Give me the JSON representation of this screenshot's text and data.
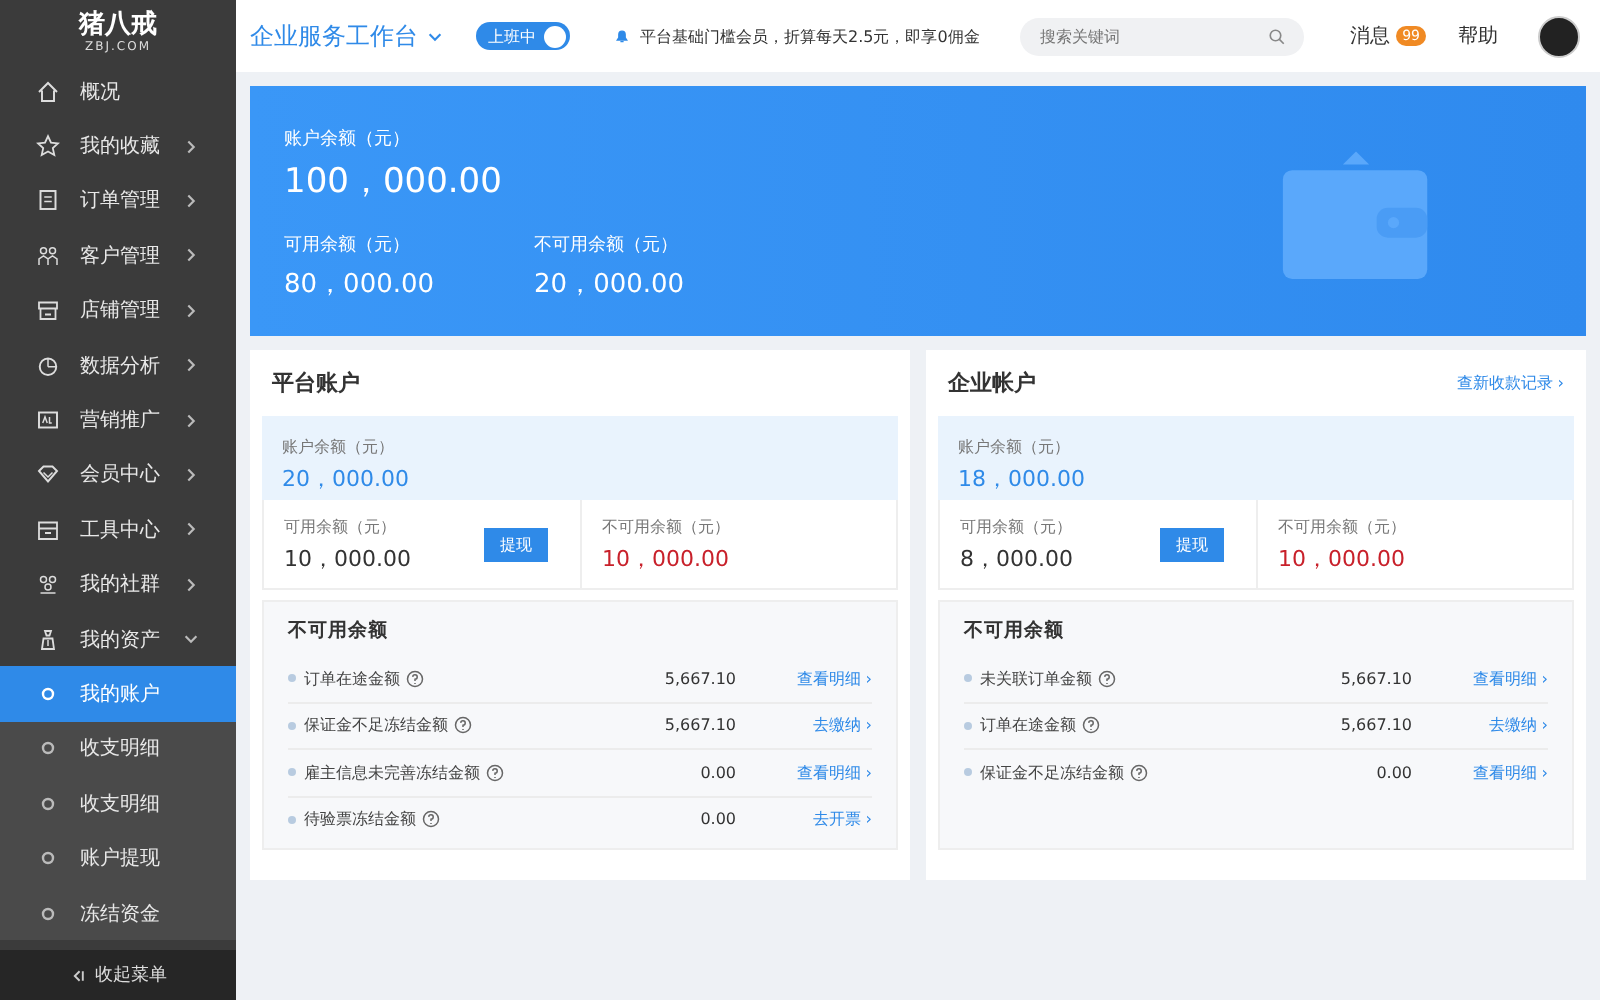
{
  "sidebar": {
    "logo": {
      "name": "猪八戒",
      "domain": "ZBJ.COM"
    },
    "items": [
      {
        "label": "概况",
        "kind": "link"
      },
      {
        "label": "我的收藏",
        "kind": "menu",
        "expanded": false
      },
      {
        "label": "订单管理",
        "kind": "menu",
        "expanded": false
      },
      {
        "label": "客户管理",
        "kind": "menu",
        "expanded": false
      },
      {
        "label": "店铺管理",
        "kind": "menu",
        "expanded": false
      },
      {
        "label": "数据分析",
        "kind": "menu",
        "expanded": false
      },
      {
        "label": "营销推广",
        "kind": "menu",
        "expanded": false
      },
      {
        "label": "会员中心",
        "kind": "menu",
        "expanded": false
      },
      {
        "label": "工具中心",
        "kind": "menu",
        "expanded": false
      },
      {
        "label": "我的社群",
        "kind": "menu",
        "expanded": false
      },
      {
        "label": "我的资产",
        "kind": "menu",
        "expanded": true,
        "children": [
          {
            "label": "我的账户",
            "selected": true
          },
          {
            "label": "收支明细",
            "selected": false
          },
          {
            "label": "收支明细",
            "selected": false
          },
          {
            "label": "账户提现",
            "selected": false
          },
          {
            "label": "冻结资金",
            "selected": false
          }
        ]
      }
    ],
    "collapse": "收起菜单"
  },
  "header": {
    "title": "企业服务工作台",
    "status": {
      "label": "上班中",
      "on": true
    },
    "notice": "平台基础门槛会员，折算每天2.5元，即享0佣金",
    "search": {
      "placeholder": "搜索关键词"
    },
    "messages": {
      "label": "消息",
      "count": "99"
    },
    "help": "帮助"
  },
  "banner": {
    "label": "账户余额（元）",
    "amount": "100，000.00",
    "sub": [
      {
        "label": "可用余额（元）",
        "amount": "80，000.00"
      },
      {
        "label": "不可用余额（元）",
        "amount": "20，000.00"
      }
    ]
  },
  "accounts": [
    {
      "title": "平台账户",
      "balance": {
        "label": "账户余额（元）",
        "amount": "20，000.00"
      },
      "available": {
        "label": "可用余额（元）",
        "amount": "10，000.00",
        "button": "提现"
      },
      "unavailable": {
        "label": "不可用余额（元）",
        "amount": "10，000.00"
      },
      "details": {
        "title": "不可用余额",
        "rows": [
          {
            "label": "订单在途金额",
            "amount": "5,667.10",
            "link": "查看明细 ›"
          },
          {
            "label": "保证金不足冻结金额",
            "amount": "5,667.10",
            "link": "去缴纳 ›"
          },
          {
            "label": "雇主信息未完善冻结金额",
            "amount": "0.00",
            "link": "查看明细 ›"
          },
          {
            "label": "待验票冻结金额",
            "amount": "0.00",
            "link": "去开票 ›"
          }
        ]
      }
    },
    {
      "title": "企业帐户",
      "link": "查新收款记录 ›",
      "balance": {
        "label": "账户余额（元）",
        "amount": "18，000.00"
      },
      "available": {
        "label": "可用余额（元）",
        "amount": "8，000.00",
        "button": "提现"
      },
      "unavailable": {
        "label": "不可用余额（元）",
        "amount": "10，000.00"
      },
      "details": {
        "title": "不可用余额",
        "rows": [
          {
            "label": "未关联订单金额",
            "amount": "5,667.10",
            "link": "查看明细 ›"
          },
          {
            "label": "订单在途金额",
            "amount": "5,667.10",
            "link": "去缴纳 ›"
          },
          {
            "label": "保证金不足冻结金额",
            "amount": "0.00",
            "link": "查看明细 ›"
          }
        ]
      }
    }
  ]
}
